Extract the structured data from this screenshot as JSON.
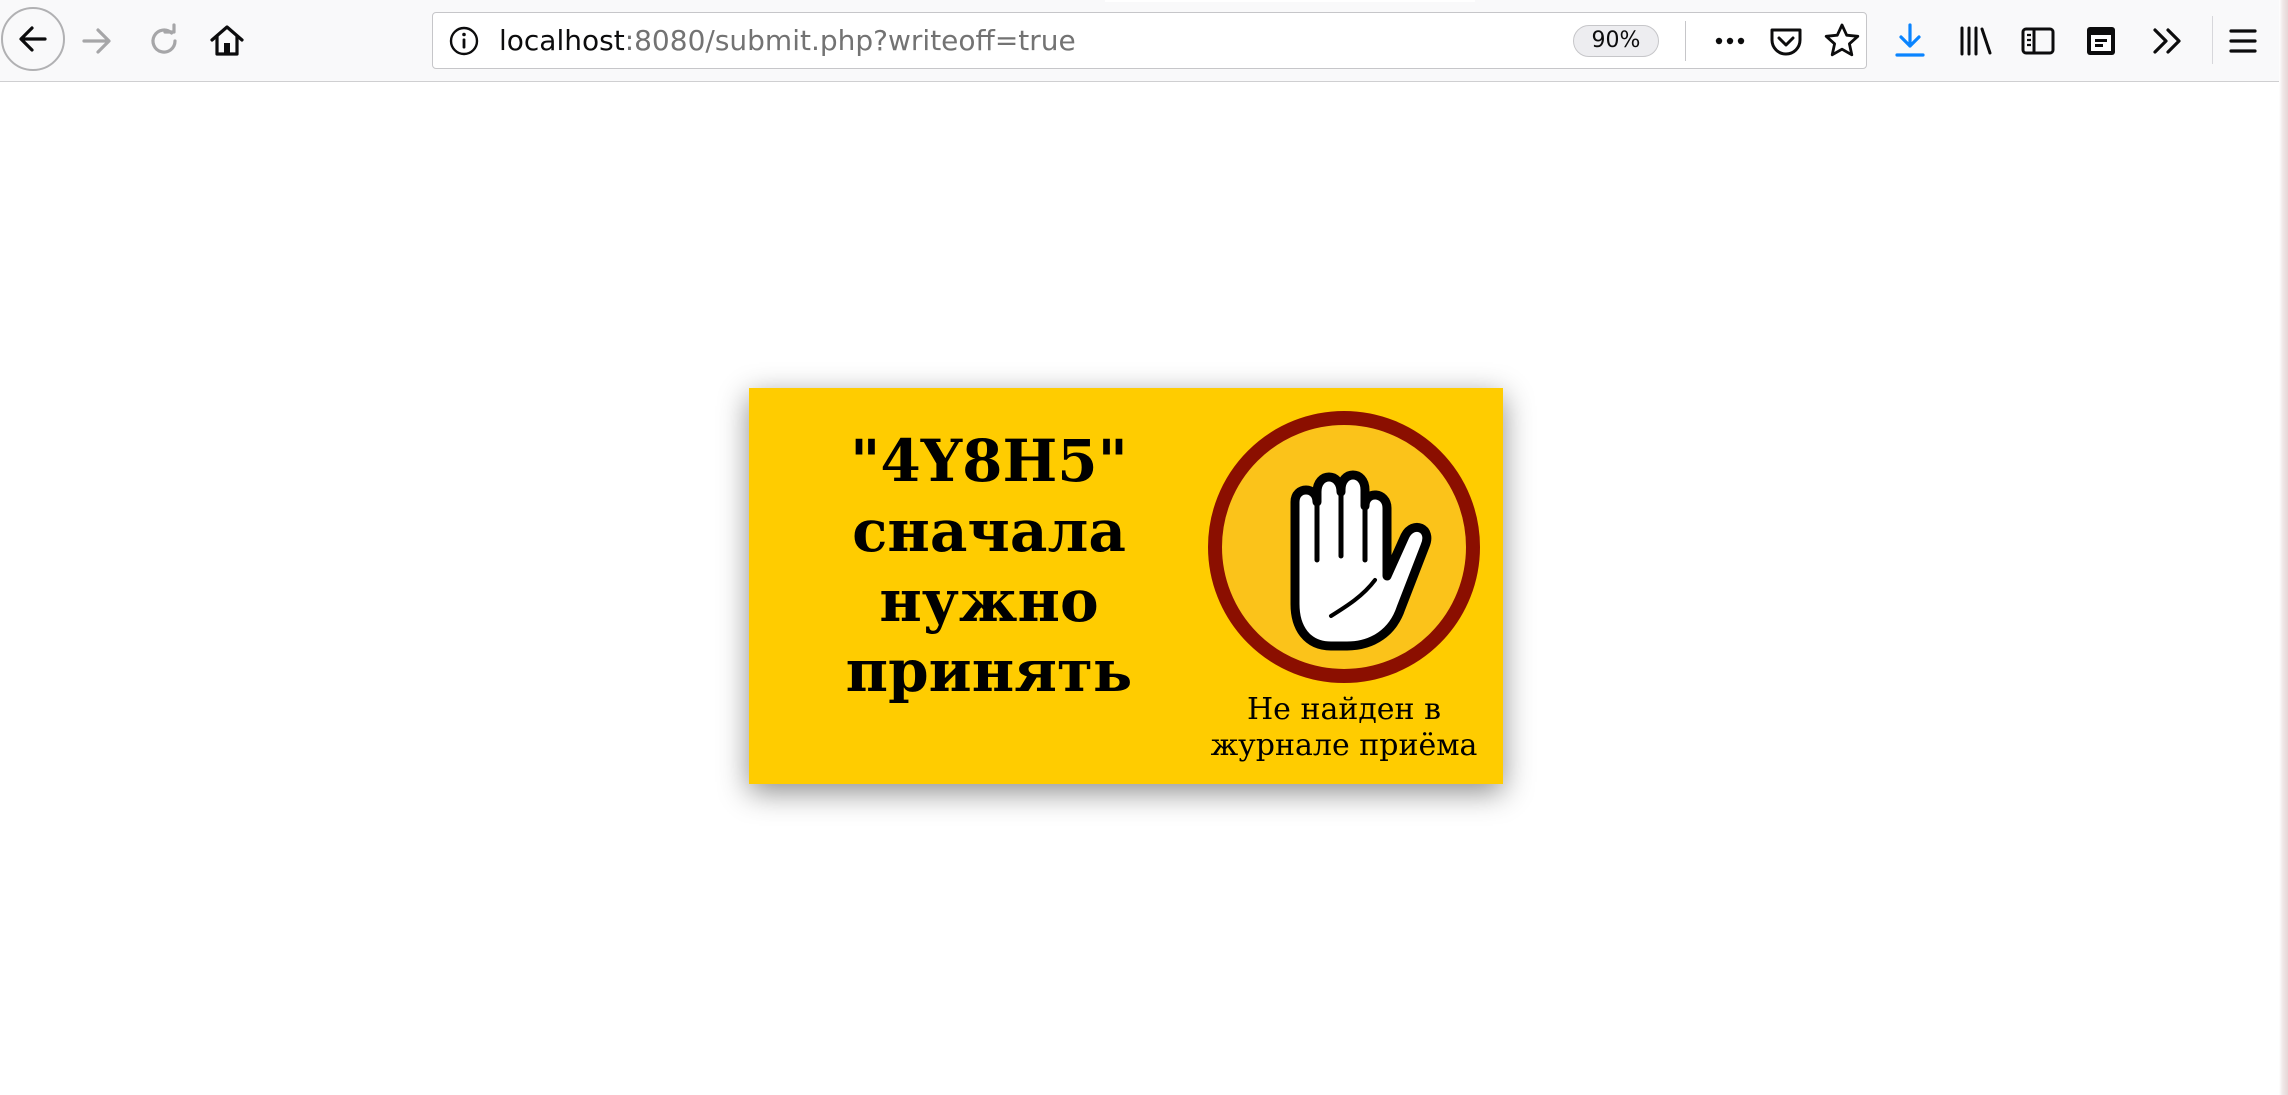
{
  "browser": {
    "url": {
      "host": "localhost",
      "rest": ":8080/submit.php?writeoff=true"
    },
    "zoom": "90%"
  },
  "toolbar": {
    "icons": [
      "back-icon",
      "forward-icon",
      "reload-icon",
      "home-icon",
      "site-info-icon",
      "page-actions-icon",
      "pocket-icon",
      "bookmark-star-icon",
      "downloads-icon",
      "library-icon",
      "sidebar-icon",
      "container-icon",
      "overflow-icon",
      "menu-icon"
    ],
    "download_color": "#0a84ff"
  },
  "banner": {
    "background": "#ffcc00",
    "headline": [
      "\"4Y8H5\"",
      "сначала",
      "нужно",
      "принять"
    ],
    "caption": [
      "Не найден в",
      "журнале приёма"
    ],
    "sign": {
      "icon": "stop-hand-icon",
      "ring_color": "#8b0f00",
      "fill_color": "#fbc31a"
    }
  }
}
